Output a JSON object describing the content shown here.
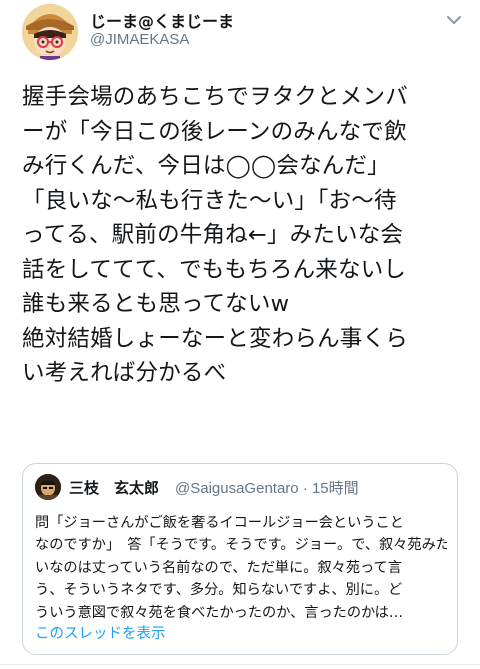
{
  "author": {
    "display_name": "じーま@くまじーま",
    "handle": "@JIMAEKASA",
    "avatar_icon": "anime-avatar-icon"
  },
  "more_icon": "chevron-down-icon",
  "tweet": {
    "lines": [
      "握手会場のあちこちでヲタクとメンバ",
      "ーが「今日この後レーンのみんなで飲",
      "み行くんだ、今日は◯◯会なんだ」",
      "「良いな〜私も行きた〜い」「お〜待",
      "ってる、駅前の牛角ね←」みたいな会",
      "話をしててて、でももちろん来ないし",
      "誰も来るとも思ってないw",
      "絶対結婚しょーなーと変わらん事くら",
      "い考えれば分かるべ"
    ]
  },
  "quoted_tweet": {
    "display_name": "三枝　玄太郎",
    "handle_time": "@SaigusaGentaro · 15時間",
    "avatar_icon": "profile-photo-icon",
    "lines": [
      "問「ジョーさんがご飯を奢るイコールジョー会ということ",
      "なのですか」　答「そうです。そうです。ジョー。で、叙々苑みた",
      "いなのは丈っていう名前なので、ただ単に。叙々苑って言",
      "う、そういうネタです、多分。知らないですよ、別に。ど",
      "ういう意図で叙々苑を食べたかったのか、言ったのかは…"
    ],
    "show_thread": "このスレッドを表示"
  },
  "colors": {
    "link": "#1da1f2",
    "secondary_text": "#657786",
    "border": "#ccd6dd"
  }
}
